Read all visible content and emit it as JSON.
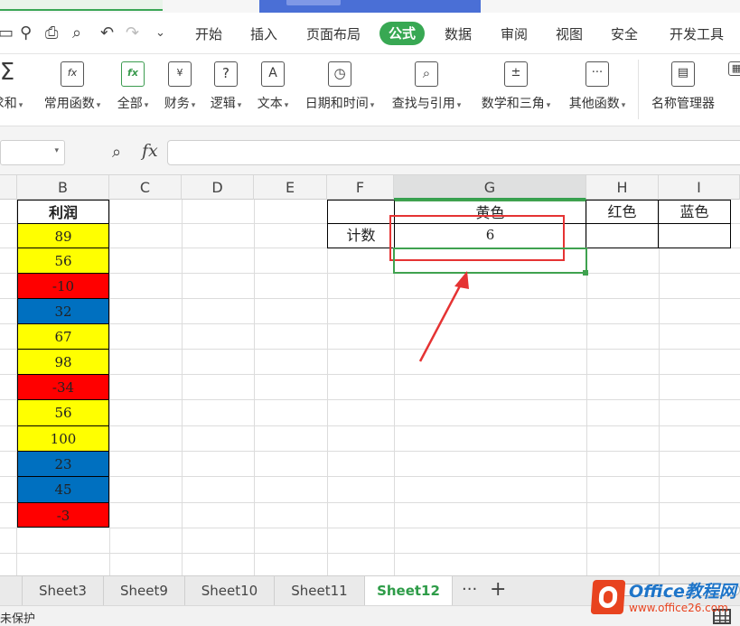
{
  "menu": {
    "items": [
      "开始",
      "插入",
      "页面布局",
      "公式",
      "数据",
      "审阅",
      "视图",
      "安全",
      "开发工具"
    ],
    "active": "公式"
  },
  "ribbon": {
    "buttons": [
      {
        "label": "求和",
        "icon": "sum-icon"
      },
      {
        "label": "常用函数",
        "icon": "common-functions-icon"
      },
      {
        "label": "全部",
        "icon": "all-functions-icon"
      },
      {
        "label": "财务",
        "icon": "finance-icon"
      },
      {
        "label": "逻辑",
        "icon": "logic-icon"
      },
      {
        "label": "文本",
        "icon": "text-function-icon"
      },
      {
        "label": "日期和时间",
        "icon": "datetime-icon"
      },
      {
        "label": "查找与引用",
        "icon": "lookup-icon"
      },
      {
        "label": "数学和三角",
        "icon": "math-icon"
      },
      {
        "label": "其他函数",
        "icon": "other-functions-icon"
      }
    ],
    "name_manager": "名称管理器"
  },
  "formula_bar": {
    "fx": "fx",
    "name_box": "",
    "formula": ""
  },
  "columns": [
    "B",
    "C",
    "D",
    "E",
    "F",
    "G",
    "H",
    "I"
  ],
  "sheet": {
    "b_header": "利润",
    "profits": [
      {
        "value": "89",
        "color": "#ffff00"
      },
      {
        "value": "56",
        "color": "#ffff00"
      },
      {
        "value": "-10",
        "color": "#ff0000"
      },
      {
        "value": "32",
        "color": "#0070c0"
      },
      {
        "value": "67",
        "color": "#ffff00"
      },
      {
        "value": "98",
        "color": "#ffff00"
      },
      {
        "value": "-34",
        "color": "#ff0000"
      },
      {
        "value": "56",
        "color": "#ffff00"
      },
      {
        "value": "100",
        "color": "#ffff00"
      },
      {
        "value": "23",
        "color": "#0070c0"
      },
      {
        "value": "45",
        "color": "#0070c0"
      },
      {
        "value": "-3",
        "color": "#ff0000"
      }
    ],
    "color_headers": {
      "yellow": "黄色",
      "red": "红色",
      "blue": "蓝色"
    },
    "count_label": "计数",
    "yellow_count": "6"
  },
  "sheet_tabs": [
    "Sheet3",
    "Sheet9",
    "Sheet10",
    "Sheet11",
    "Sheet12"
  ],
  "active_sheet": "Sheet12",
  "tab_more": "···",
  "tab_add": "+",
  "status": {
    "text": "未保护"
  },
  "watermark": {
    "title": "Office教程网",
    "url": "www.office26.com"
  }
}
